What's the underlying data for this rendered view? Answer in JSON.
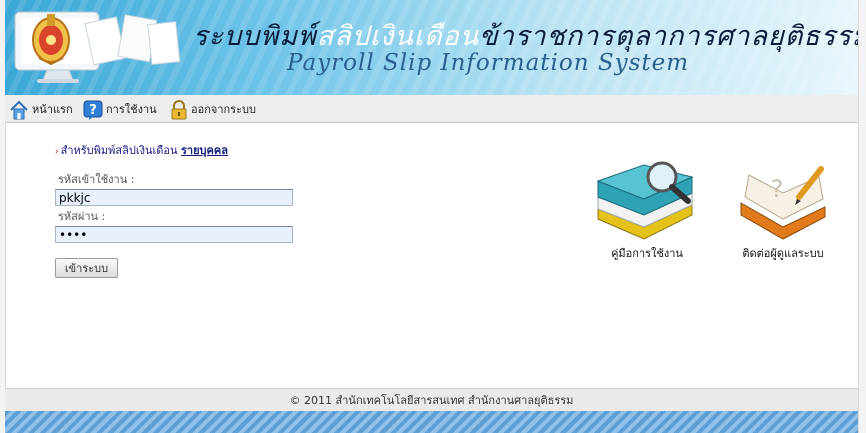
{
  "header": {
    "title_th_part1": "ระบบพิมพ์",
    "title_th_part2": "สลิปเงินเดือน",
    "title_th_part3": "ข้าราชการตุลาการศาลยุติธรรม",
    "title_en": "Payroll Slip Information System"
  },
  "nav": {
    "home": "หน้าแรก",
    "help": "การใช้งาน",
    "logout": "ออกจากระบบ"
  },
  "login": {
    "intro_text": "สำหรับพิมพ์สลิปเงินเดือน",
    "intro_link": "รายบุคคล",
    "username_label": "รหัสเข้าใช้งาน :",
    "username_value": "pkkjc",
    "password_label": "รหัสผ่าน :",
    "password_value": "••••",
    "submit_label": "เข้าระบบ"
  },
  "shortcuts": {
    "manual": "คู่มือการใช้งาน",
    "contact": "ติดต่อผู้ดูแลระบบ"
  },
  "footer": {
    "text": "© 2011 สำนักเทคโนโลยีสารสนเทศ สำนักงานศาลยุติธรรม"
  },
  "colors": {
    "header_blue": "#3aa7d6",
    "link_navy": "#12207a",
    "input_bg": "#e8f0fe"
  }
}
